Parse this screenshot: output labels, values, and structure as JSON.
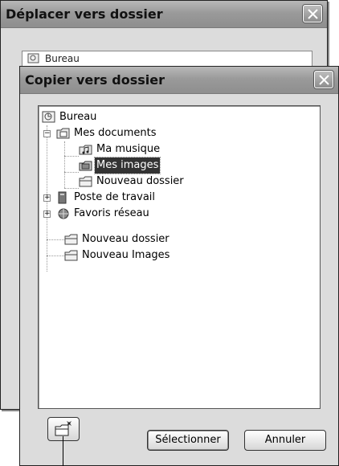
{
  "back_window": {
    "title": "Déplacer vers dossier",
    "visible_tree_root": "Bureau"
  },
  "front_window": {
    "title": "Copier vers dossier",
    "tree": {
      "root": "Bureau",
      "items": [
        {
          "label": "Mes documents",
          "icon": "documents-folder-icon",
          "expander": "−"
        },
        {
          "label": "Ma musique",
          "icon": "music-folder-icon"
        },
        {
          "label": "Mes images",
          "icon": "pictures-folder-icon",
          "selected": true
        },
        {
          "label": "Nouveau dossier",
          "icon": "folder-icon"
        },
        {
          "label": "Poste de travail",
          "icon": "computer-icon",
          "expander": "+"
        },
        {
          "label": "Favoris réseau",
          "icon": "network-icon",
          "expander": "+"
        },
        {
          "label": "Nouveau dossier",
          "icon": "folder-icon"
        },
        {
          "label": "Nouveau Images",
          "icon": "folder-icon"
        }
      ]
    },
    "buttons": {
      "new_folder_icon": "new-folder-icon",
      "select": "Sélectionner",
      "cancel": "Annuler"
    }
  }
}
